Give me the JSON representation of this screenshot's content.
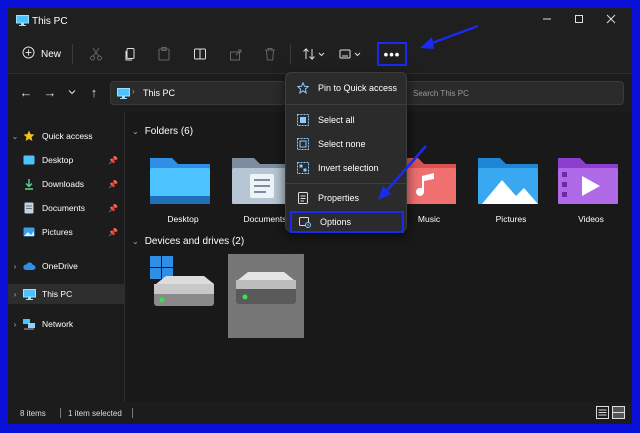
{
  "window": {
    "title": "This PC",
    "minimize_icon": "minimize-icon",
    "maximize_icon": "maximize-icon",
    "close_icon": "close-icon"
  },
  "toolbar": {
    "new_label": "New",
    "more_label": "•••"
  },
  "address": {
    "path": "This PC",
    "search_placeholder": "Search This PC"
  },
  "nav": {
    "items": [
      {
        "label": "Quick access"
      },
      {
        "label": "Desktop"
      },
      {
        "label": "Downloads"
      },
      {
        "label": "Documents"
      },
      {
        "label": "Pictures"
      },
      {
        "label": "OneDrive"
      },
      {
        "label": "This PC"
      },
      {
        "label": "Network"
      }
    ]
  },
  "content": {
    "folders_header": "Folders (6)",
    "folders": [
      {
        "label": "Desktop"
      },
      {
        "label": "Documents"
      },
      {
        "label": "Music"
      },
      {
        "label": "Pictures"
      },
      {
        "label": "Videos"
      }
    ],
    "drives_header": "Devices and drives (2)"
  },
  "menu": {
    "items": [
      {
        "label": "Pin to Quick access"
      },
      {
        "label": "Select all"
      },
      {
        "label": "Select none"
      },
      {
        "label": "Invert selection"
      },
      {
        "label": "Properties"
      },
      {
        "label": "Options"
      }
    ]
  },
  "status": {
    "items": "8 items",
    "selected": "1 item selected"
  },
  "colors": {
    "annotation": "#1a2af0",
    "accent": "#4cc2ff",
    "background": "#1c1c1c"
  }
}
